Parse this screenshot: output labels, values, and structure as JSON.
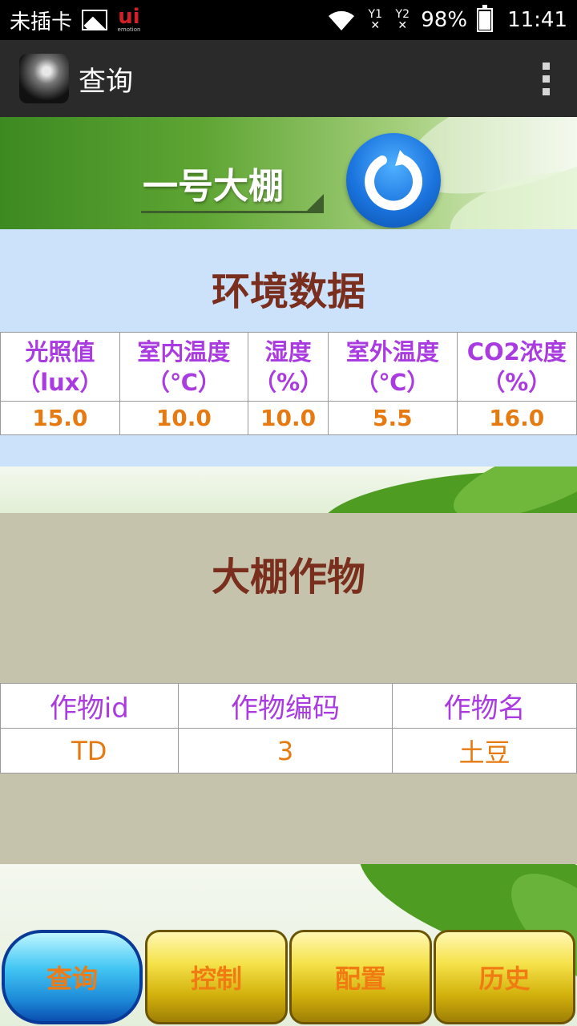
{
  "status_bar": {
    "carrier": "未插卡",
    "sim1_label": "Y1",
    "sim2_label": "Y2",
    "battery": "98%",
    "time": "11:41"
  },
  "action_bar": {
    "title": "查询"
  },
  "banner": {
    "greenhouse_name": "一号大棚"
  },
  "environment": {
    "title": "环境数据",
    "headers": [
      "光照值（lux）",
      "室内温度（℃）",
      "湿度（%）",
      "室外温度（℃）",
      "CO2浓度（%）"
    ],
    "values": [
      "15.0",
      "10.0",
      "10.0",
      "5.5",
      "16.0"
    ]
  },
  "crops": {
    "title": "大棚作物",
    "headers": [
      "作物id",
      "作物编码",
      "作物名"
    ],
    "values": [
      "TD",
      "3",
      "土豆"
    ]
  },
  "nav": {
    "query": "查询",
    "control": "控制",
    "config": "配置",
    "history": "历史"
  },
  "colors": {
    "header_text": "#a93be0",
    "value_text": "#e67a10",
    "section_title": "#7a2e1e",
    "env_bg": "#cce1fa",
    "crop_bg": "#c5c3ab"
  }
}
